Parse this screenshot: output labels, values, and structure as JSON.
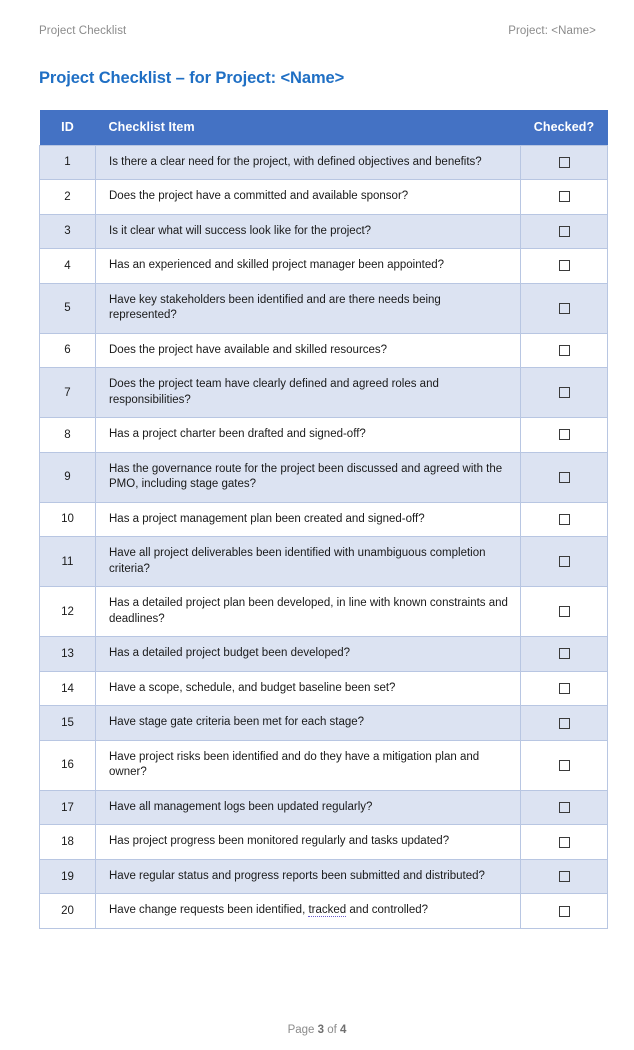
{
  "running_header": {
    "left": "Project Checklist",
    "right": "Project: <Name>"
  },
  "doc_title": "Project Checklist – for Project: <Name>",
  "table": {
    "columns": {
      "id": "ID",
      "item": "Checklist Item",
      "checked": "Checked?"
    },
    "rows": [
      {
        "id": "1",
        "item": "Is there a clear need for the project, with defined objectives and benefits?",
        "checked": false
      },
      {
        "id": "2",
        "item": "Does the project have a committed and available sponsor?",
        "checked": false
      },
      {
        "id": "3",
        "item": "Is it clear what will success look like for the project?",
        "checked": false
      },
      {
        "id": "4",
        "item": "Has an experienced and skilled project manager been appointed?",
        "checked": false
      },
      {
        "id": "5",
        "item": "Have key stakeholders been identified and are there needs being represented?",
        "checked": false
      },
      {
        "id": "6",
        "item": "Does the project have available and skilled resources?",
        "checked": false
      },
      {
        "id": "7",
        "item": "Does the project team have clearly defined and agreed roles and responsibilities?",
        "checked": false
      },
      {
        "id": "8",
        "item": "Has a project charter been drafted and signed-off?",
        "checked": false
      },
      {
        "id": "9",
        "item": "Has the governance route for the project been discussed and agreed with the PMO, including stage gates?",
        "checked": false
      },
      {
        "id": "10",
        "item": "Has a project management plan been created and signed-off?",
        "checked": false
      },
      {
        "id": "11",
        "item": "Have all project deliverables been identified with unambiguous completion criteria?",
        "checked": false
      },
      {
        "id": "12",
        "item": "Has a detailed project plan been developed, in line with known constraints and deadlines?",
        "checked": false
      },
      {
        "id": "13",
        "item": "Has a detailed project budget been developed?",
        "checked": false
      },
      {
        "id": "14",
        "item": "Have a scope, schedule, and budget baseline been set?",
        "checked": false
      },
      {
        "id": "15",
        "item": "Have stage gate criteria been met for each stage?",
        "checked": false
      },
      {
        "id": "16",
        "item": "Have project risks been identified and do they have a mitigation plan and owner?",
        "checked": false
      },
      {
        "id": "17",
        "item": "Have all management logs been updated regularly?",
        "checked": false
      },
      {
        "id": "18",
        "item": "Has project progress been monitored regularly and tasks updated?",
        "checked": false
      },
      {
        "id": "19",
        "item": "Have regular status and progress reports been submitted and distributed?",
        "checked": false
      },
      {
        "id": "20",
        "item": "Have change requests been identified, tracked and controlled?",
        "checked": false,
        "spell_flagged_word": "tracked"
      }
    ]
  },
  "footer": {
    "prefix": "Page ",
    "current_page": "3",
    "middle": " of ",
    "total_pages": "4"
  },
  "colors": {
    "header_blue": "#4472C4",
    "shaded_row": "#DCE3F2",
    "title_blue": "#1F6FC4",
    "border": "#B8C6E2",
    "muted_text": "#8B8B8B",
    "spellcheck_underline": "#6A5ACD"
  }
}
